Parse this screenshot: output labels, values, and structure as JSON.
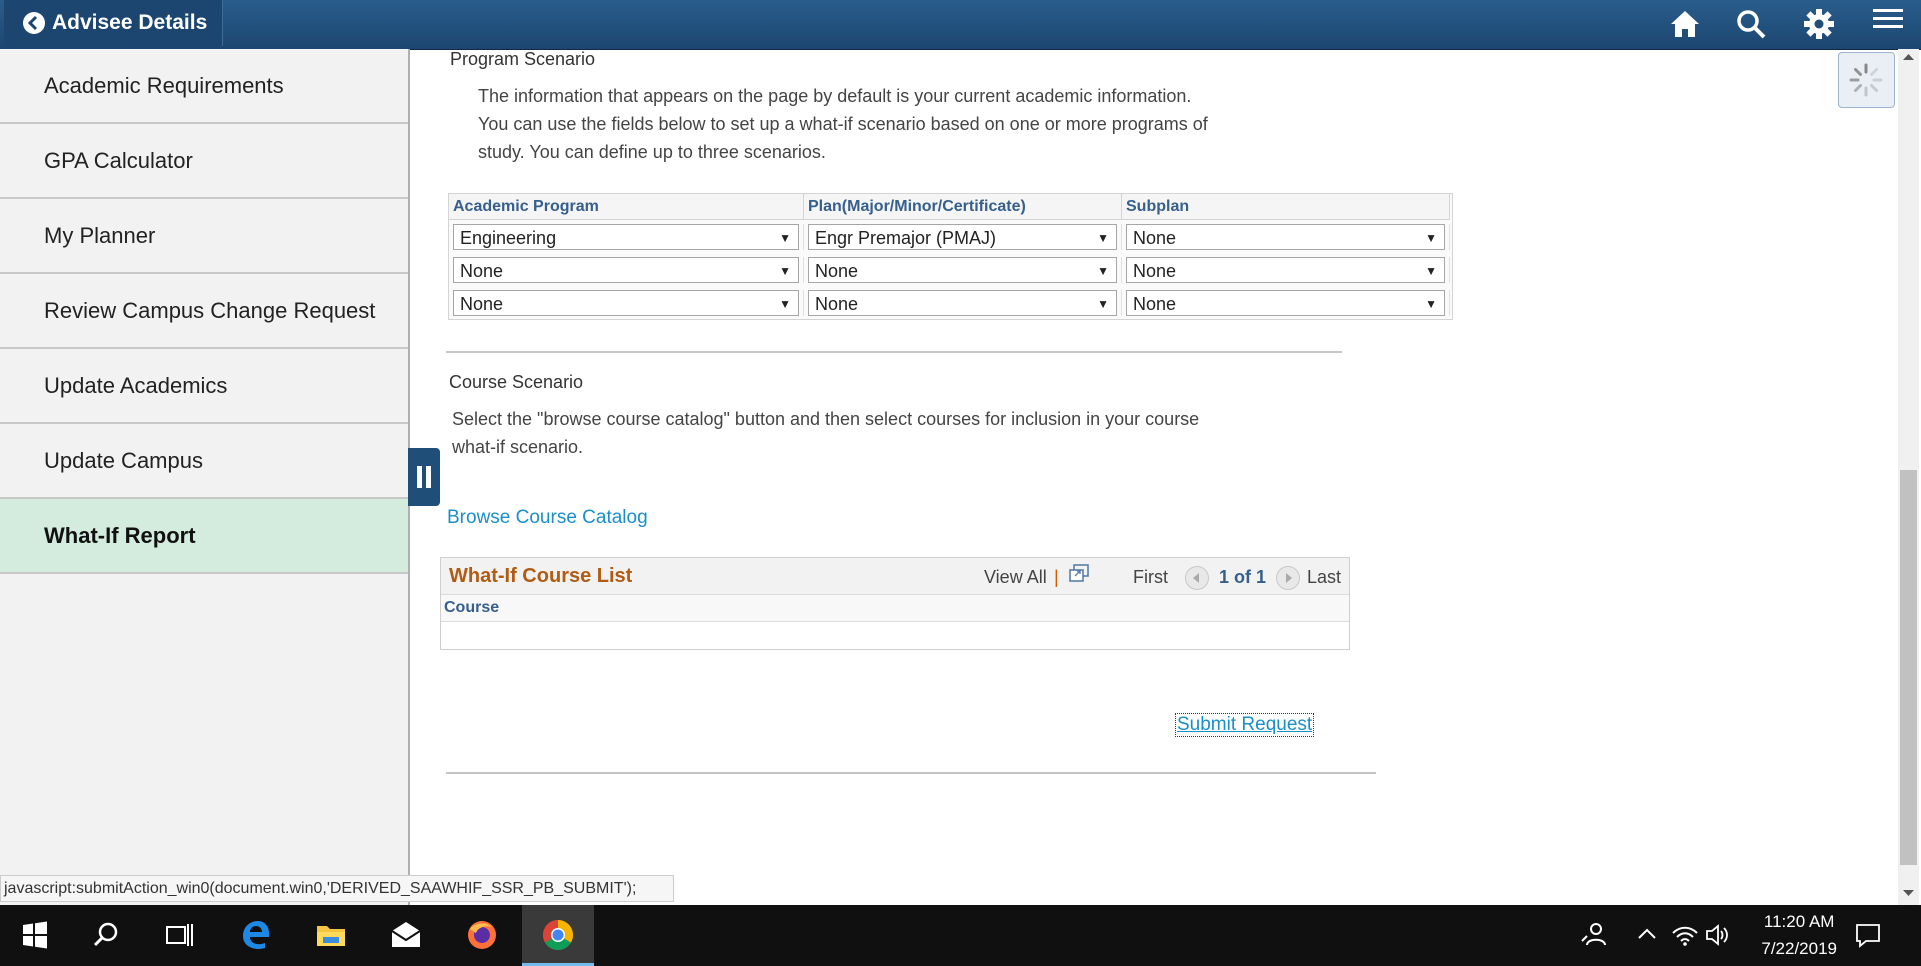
{
  "header": {
    "back_title": "Advisee Details",
    "icons": [
      "home-icon",
      "search-icon",
      "gear-icon",
      "hamburger-menu-icon"
    ]
  },
  "sidebar": {
    "items": [
      {
        "label": "Academic Requirements"
      },
      {
        "label": "GPA Calculator"
      },
      {
        "label": "My Planner"
      },
      {
        "label": "Review Campus Change Request"
      },
      {
        "label": "Update Academics"
      },
      {
        "label": "Update Campus"
      },
      {
        "label": "What-If Report",
        "active": true
      }
    ]
  },
  "program_scenario": {
    "title": "Program Scenario",
    "description": "The information that appears on the page by default is your current academic information. You can use the fields below to set up a what-if scenario based on one or more programs of study. You can define up to three scenarios.",
    "columns": [
      "Academic Program",
      "Plan(Major/Minor/Certificate)",
      "Subplan"
    ],
    "rows": [
      [
        "Engineering",
        "Engr Premajor (PMAJ)",
        "None"
      ],
      [
        "None",
        "None",
        "None"
      ],
      [
        "None",
        "None",
        "None"
      ]
    ]
  },
  "course_scenario": {
    "title": "Course Scenario",
    "description": "Select the \"browse course catalog\" button and then select courses for inclusion in your course what-if scenario.",
    "browse_link": "Browse Course Catalog"
  },
  "course_list": {
    "title": "What-If Course List",
    "view_all": "View All",
    "separator": "|",
    "first": "First",
    "page_info": "1 of 1",
    "last": "Last",
    "column": "Course"
  },
  "submit_link": "Submit Request",
  "status_url": "javascript:submitAction_win0(document.win0,'DERIVED_SAAWHIF_SSR_PB_SUBMIT');",
  "taskbar": {
    "time": "11:20 AM",
    "date": "7/22/2019",
    "apps": [
      "windows-start-icon",
      "search-icon",
      "task-view-icon",
      "edge-icon",
      "file-explorer-icon",
      "mail-icon",
      "firefox-icon",
      "chrome-icon"
    ]
  },
  "colors": {
    "header_bg": "#1f4e79",
    "active_sidebar": "#d3ecdd",
    "link": "#1a8fc9",
    "grid_title": "#b05c13"
  }
}
